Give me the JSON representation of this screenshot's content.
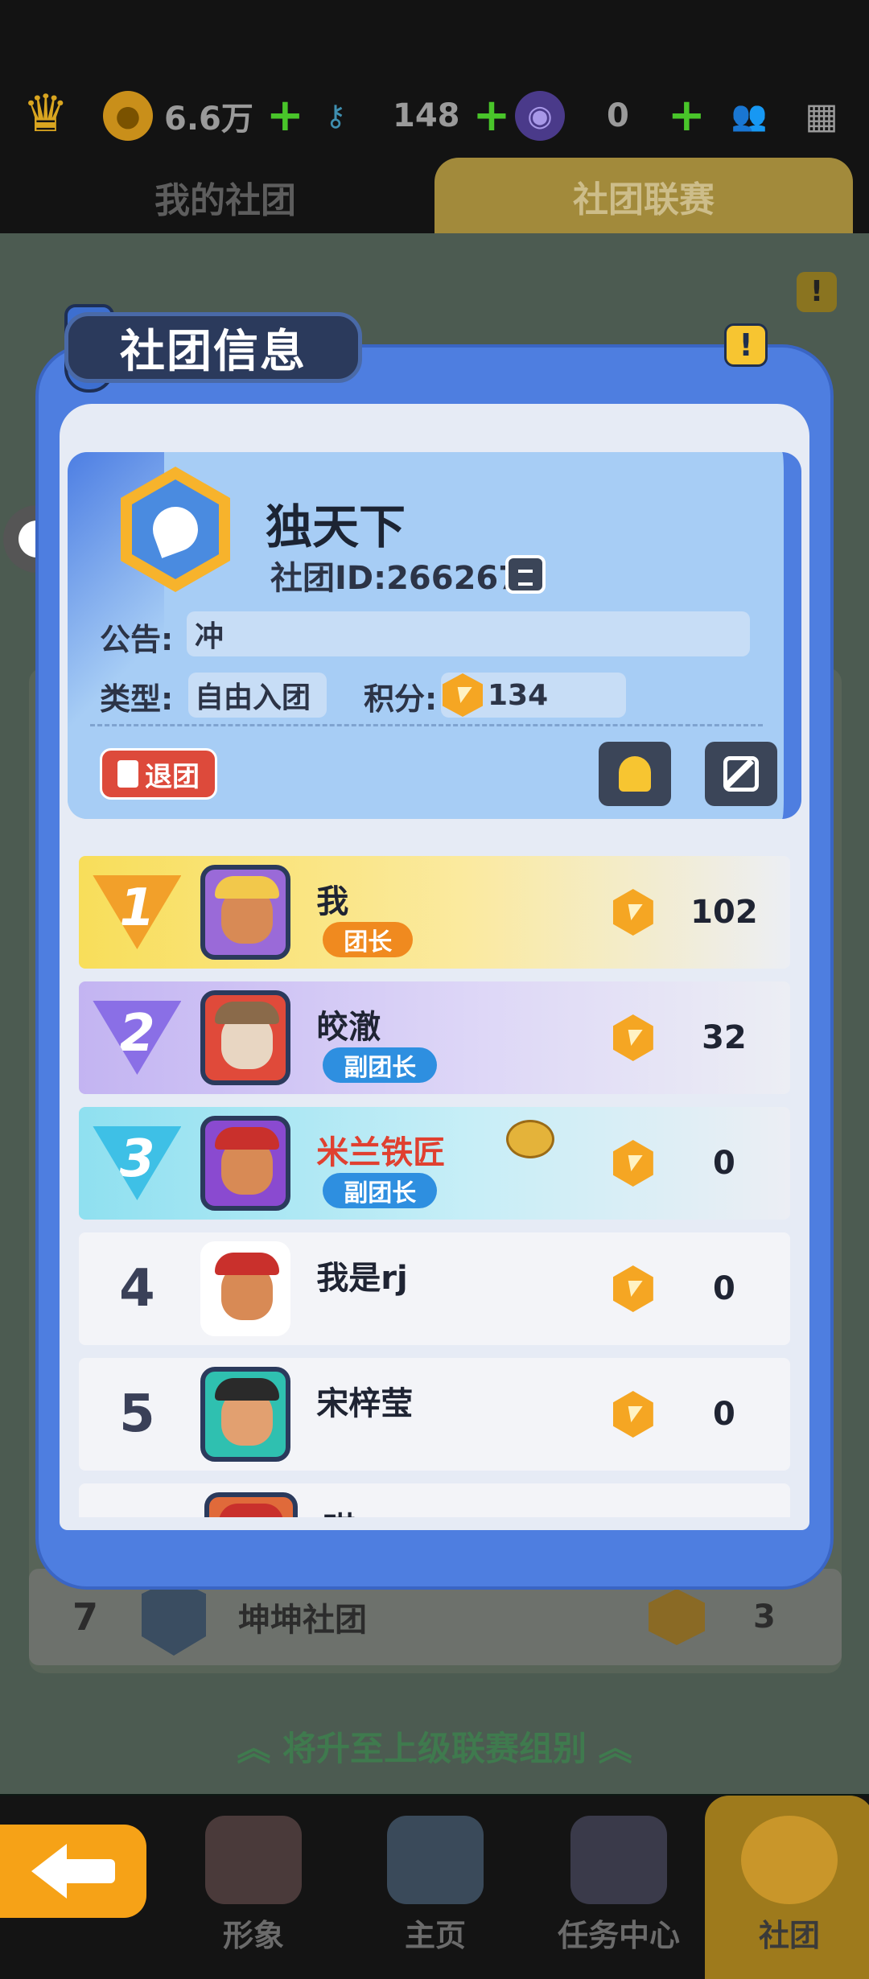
{
  "topbar": {
    "coins": "6.6万",
    "keys": "148",
    "tokens": "0",
    "plus": "+"
  },
  "tabs": {
    "my_club": "我的社团",
    "club_league": "社团联赛"
  },
  "background": {
    "row7": {
      "rank": "7",
      "name": "坤坤社团",
      "score": "3"
    },
    "promo": "将升至上级联赛组别"
  },
  "bottom_nav": [
    "形象",
    "主页",
    "任务中心",
    "社团"
  ],
  "dialog": {
    "title": "社团信息",
    "club": {
      "name": "独天下",
      "id": "社团ID:266267",
      "notice_label": "公告:",
      "notice": "冲",
      "type_label": "类型:",
      "type": "自由入团",
      "score_label": "积分:",
      "score": "134",
      "leave": "退团"
    },
    "members": [
      {
        "rank": "1",
        "name": "我",
        "role": "团长",
        "score": "102"
      },
      {
        "rank": "2",
        "name": "皎澈",
        "role": "副团长",
        "score": "32"
      },
      {
        "rank": "3",
        "name": "米兰铁匠",
        "role": "副团长",
        "score": "0"
      },
      {
        "rank": "4",
        "name": "我是rj",
        "role": "",
        "score": "0"
      },
      {
        "rank": "5",
        "name": "宋梓莹",
        "role": "",
        "score": "0"
      },
      {
        "rank": "",
        "name": "琪",
        "role": "",
        "score": ""
      }
    ]
  },
  "colors": {
    "dialog_blue": "#4e7ee0",
    "gold": "#f5a623",
    "leader_orange": "#f08a1f",
    "vice_blue": "#2e8fe0",
    "leave_red": "#dd4a3b"
  }
}
